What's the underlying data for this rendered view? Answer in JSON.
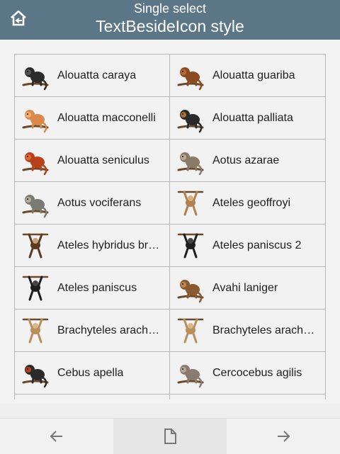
{
  "header": {
    "subtitle": "Single select",
    "title": "TextBesideIcon style",
    "home_icon": "home-icon"
  },
  "items": [
    {
      "label": "Alouatta caraya",
      "icon": "howler-monkey-black-icon"
    },
    {
      "label": "Alouatta guariba",
      "icon": "howler-monkey-brown-icon"
    },
    {
      "label": "Alouatta macconelli",
      "icon": "howler-monkey-orange-icon"
    },
    {
      "label": "Alouatta palliata",
      "icon": "howler-monkey-mantled-icon"
    },
    {
      "label": "Alouatta seniculus",
      "icon": "howler-monkey-red-icon"
    },
    {
      "label": "Aotus azarae",
      "icon": "night-monkey-icon"
    },
    {
      "label": "Aotus vociferans",
      "icon": "night-monkey-grey-icon"
    },
    {
      "label": "Ateles geoffroyi",
      "icon": "spider-monkey-icon"
    },
    {
      "label": "Ateles hybridus br…",
      "icon": "spider-monkey-hanging-icon"
    },
    {
      "label": "Ateles paniscus 2",
      "icon": "spider-monkey-black-icon"
    },
    {
      "label": "Ateles paniscus",
      "icon": "spider-monkey-black-hanging-icon"
    },
    {
      "label": "Avahi laniger",
      "icon": "woolly-lemur-icon"
    },
    {
      "label": "Brachyteles arach…",
      "icon": "muriqui-icon"
    },
    {
      "label": "Brachyteles arach…",
      "icon": "muriqui-2-icon"
    },
    {
      "label": "Cebus apella",
      "icon": "capuchin-icon"
    },
    {
      "label": "Cercocebus agilis",
      "icon": "mangabey-icon"
    },
    {
      "label": "",
      "icon": "monkey-partial-icon"
    },
    {
      "label": "",
      "icon": "monkey-partial-icon"
    }
  ],
  "footer": {
    "prev_icon": "arrow-left-icon",
    "doc_icon": "document-icon",
    "next_icon": "arrow-right-icon"
  },
  "colors": {
    "header_bg": "#5b7686",
    "cell_bg": "#f2f2f2",
    "grid_line": "#b8b8b8"
  }
}
